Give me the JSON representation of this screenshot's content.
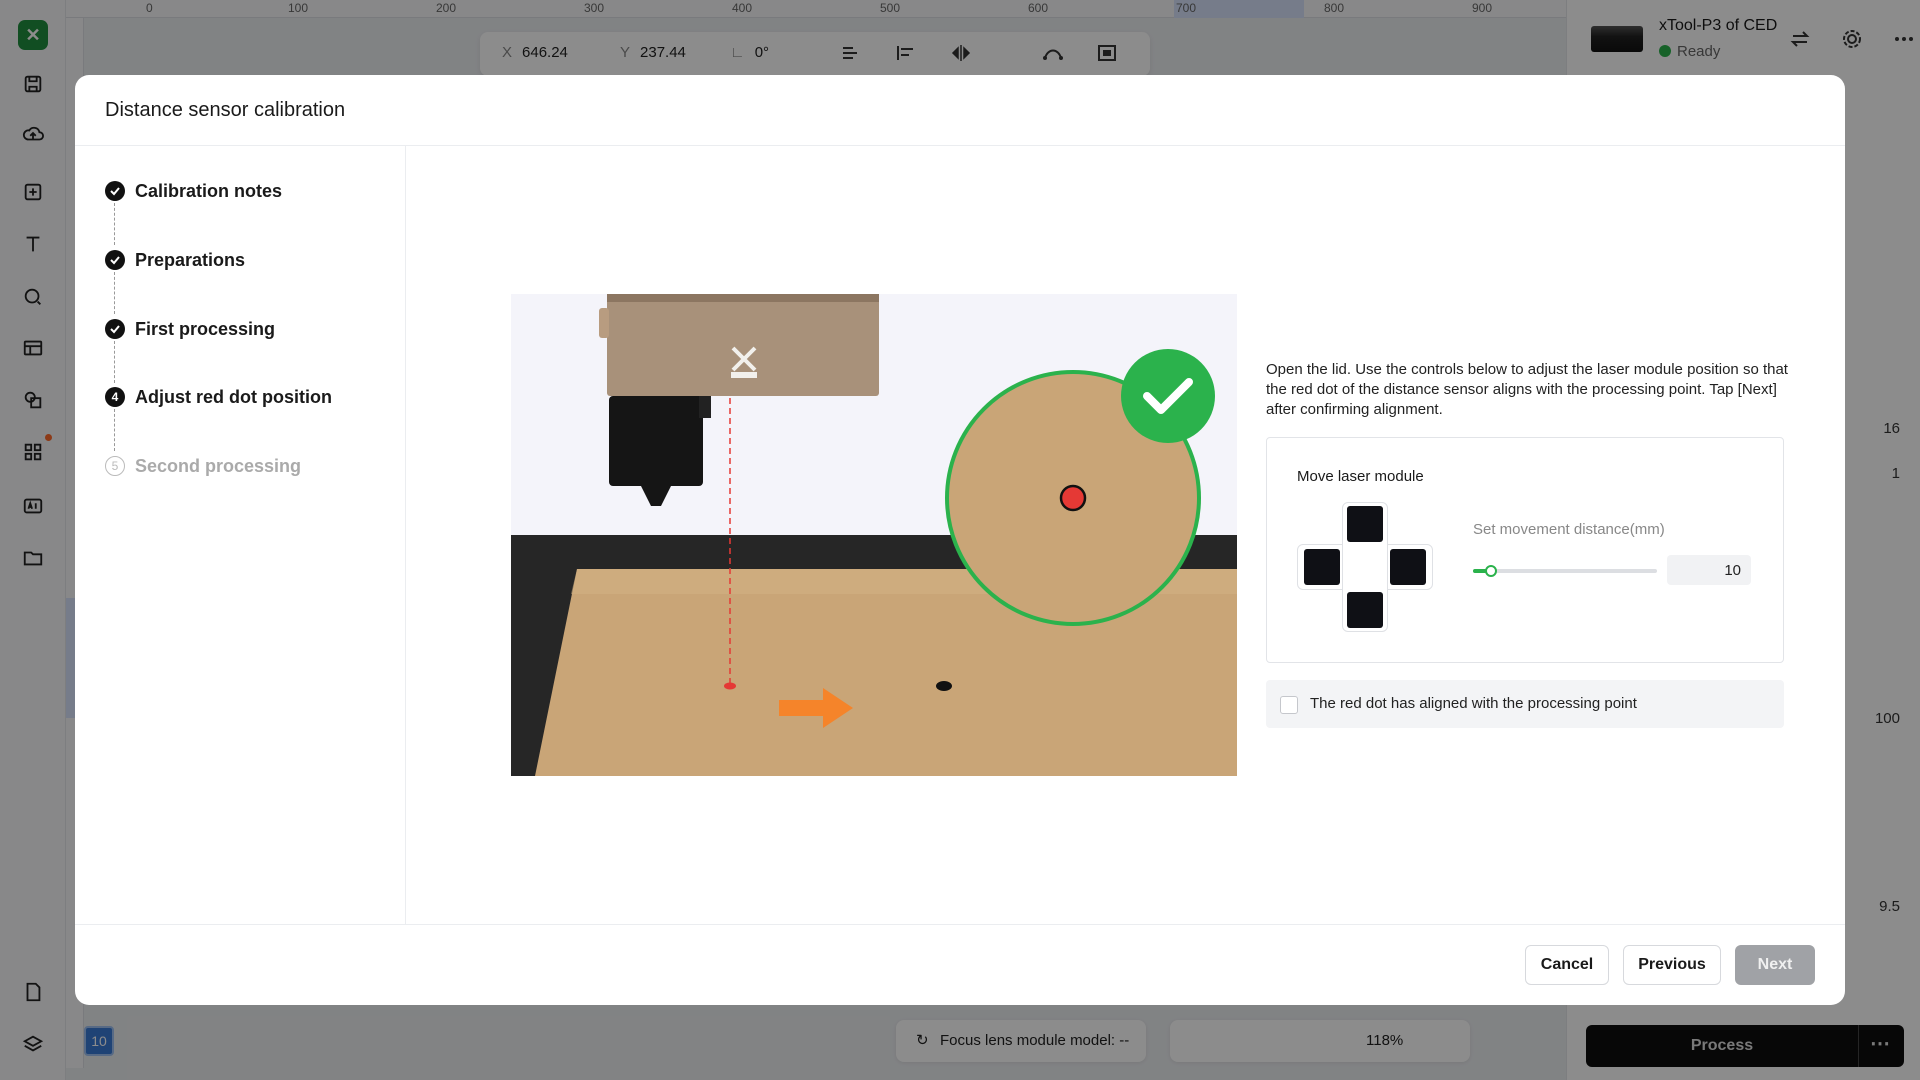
{
  "background": {
    "ruler_ticks": [
      "0",
      "100",
      "200",
      "300",
      "400",
      "500",
      "600",
      "700",
      "800",
      "900"
    ],
    "coords": {
      "x_label": "X",
      "x_value": "646.24",
      "y_label": "Y",
      "y_value": "237.44",
      "angle": "0°"
    },
    "device": {
      "name": "xTool-P3 of CED",
      "status": "Ready"
    },
    "right_values": [
      "16",
      "1",
      "100",
      "9.5"
    ],
    "process_label": "Process",
    "bottom": {
      "layer_badge": "10",
      "focus_text": "Focus lens module model: --",
      "zoom": "118%"
    }
  },
  "modal": {
    "title": "Distance sensor calibration",
    "steps": [
      {
        "label": "Calibration notes",
        "state": "done"
      },
      {
        "label": "Preparations",
        "state": "done"
      },
      {
        "label": "First processing",
        "state": "done"
      },
      {
        "label": "Adjust red dot position",
        "state": "current",
        "number": "4"
      },
      {
        "label": "Second processing",
        "state": "todo",
        "number": "5"
      }
    ],
    "instruction": "Open the lid. Use the controls below to adjust the laser module position so that the red dot of the distance sensor aligns with the processing point. Tap [Next] after confirming alignment.",
    "move": {
      "title": "Move laser module",
      "distance_label": "Set movement distance(mm)",
      "distance_value": "10",
      "slider_fraction": 0.1
    },
    "confirm_text": "The red dot has aligned with the processing point",
    "buttons": {
      "cancel": "Cancel",
      "previous": "Previous",
      "next": "Next"
    }
  },
  "colors": {
    "accent_green": "#2bb24c",
    "laser_red": "#e53935",
    "arrow_orange": "#f5842a",
    "next_disabled": "#a0a2a6"
  }
}
